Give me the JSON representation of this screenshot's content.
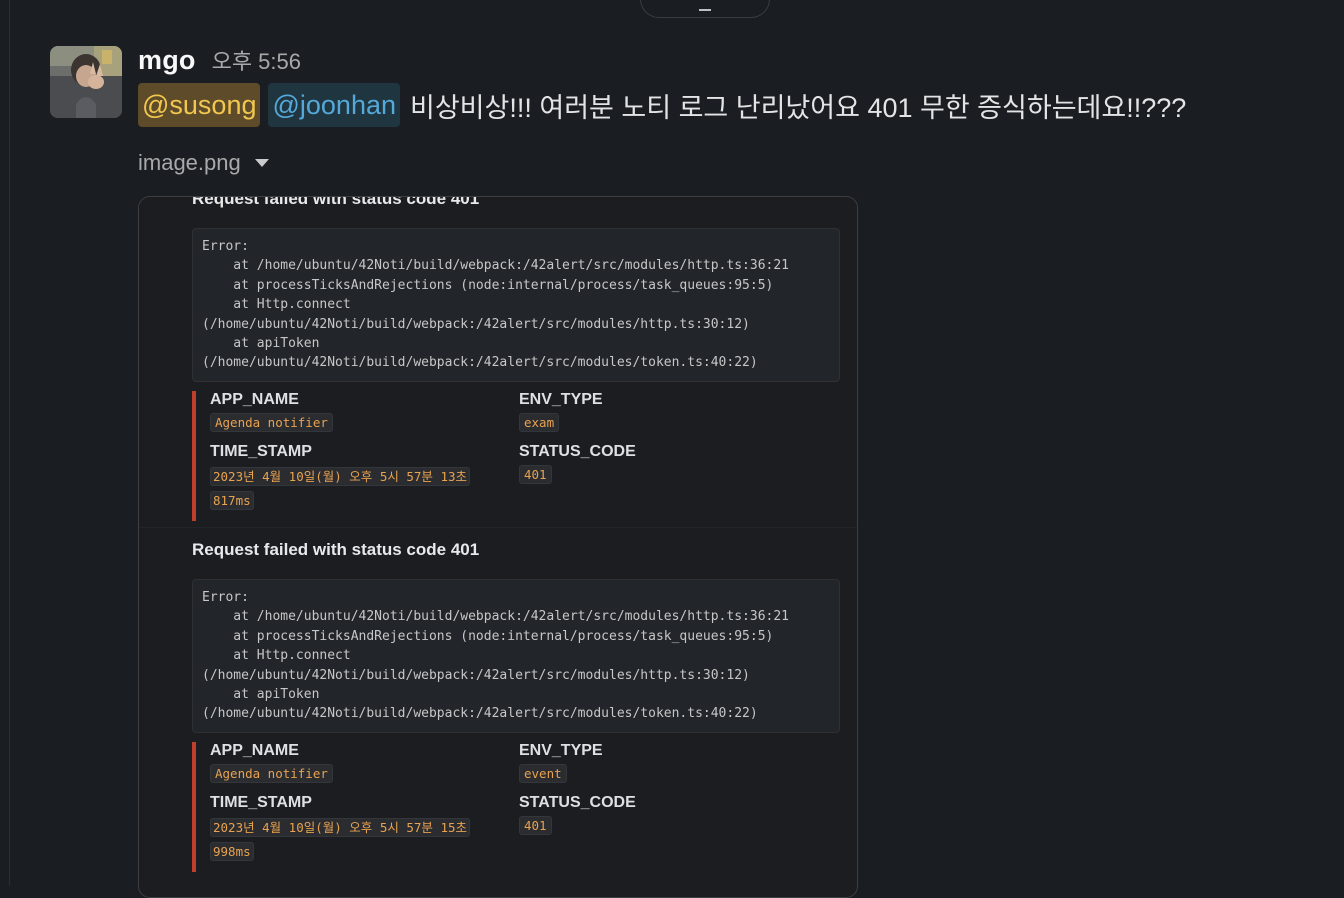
{
  "message": {
    "username": "mgo",
    "timestamp": "오후 5:56",
    "mentions": [
      "@susong",
      "@joonhan"
    ],
    "text": "비상비상!!! 여러분 노티 로그 난리났어요 401 무한 증식하는데요!!???"
  },
  "file": {
    "name": "image.png"
  },
  "attachments": [
    {
      "title": "Request failed with status code 401",
      "error_lines": [
        "Error:",
        "    at /home/ubuntu/42Noti/build/webpack:/42alert/src/modules/http.ts:36:21",
        "    at processTicksAndRejections (node:internal/process/task_queues:95:5)",
        "    at Http.connect",
        "(/home/ubuntu/42Noti/build/webpack:/42alert/src/modules/http.ts:30:12)",
        "    at apiToken",
        "(/home/ubuntu/42Noti/build/webpack:/42alert/src/modules/token.ts:40:22)"
      ],
      "fields": {
        "app_name_label": "APP_NAME",
        "app_name": "Agenda notifier",
        "env_type_label": "ENV_TYPE",
        "env_type": "exam",
        "time_stamp_label": "TIME_STAMP",
        "time_stamp_line1": "2023년 4월 10일(월) 오후 5시 57분 13초",
        "time_stamp_line2": "817ms",
        "status_code_label": "STATUS_CODE",
        "status_code": "401"
      }
    },
    {
      "title": "Request failed with status code 401",
      "error_lines": [
        "Error:",
        "    at /home/ubuntu/42Noti/build/webpack:/42alert/src/modules/http.ts:36:21",
        "    at processTicksAndRejections (node:internal/process/task_queues:95:5)",
        "    at Http.connect",
        "(/home/ubuntu/42Noti/build/webpack:/42alert/src/modules/http.ts:30:12)",
        "    at apiToken",
        "(/home/ubuntu/42Noti/build/webpack:/42alert/src/modules/token.ts:40:22)"
      ],
      "fields": {
        "app_name_label": "APP_NAME",
        "app_name": "Agenda notifier",
        "env_type_label": "ENV_TYPE",
        "env_type": "event",
        "time_stamp_label": "TIME_STAMP",
        "time_stamp_line1": "2023년 4월 10일(월) 오후 5시 57분 15초",
        "time_stamp_line2": "998ms",
        "status_code_label": "STATUS_CODE",
        "status_code": "401"
      }
    }
  ],
  "colors": {
    "accent_bar": "#c1402d",
    "mention_self": "#f2c74f",
    "mention_other": "#55a8d8",
    "code_text": "#e8a250"
  }
}
